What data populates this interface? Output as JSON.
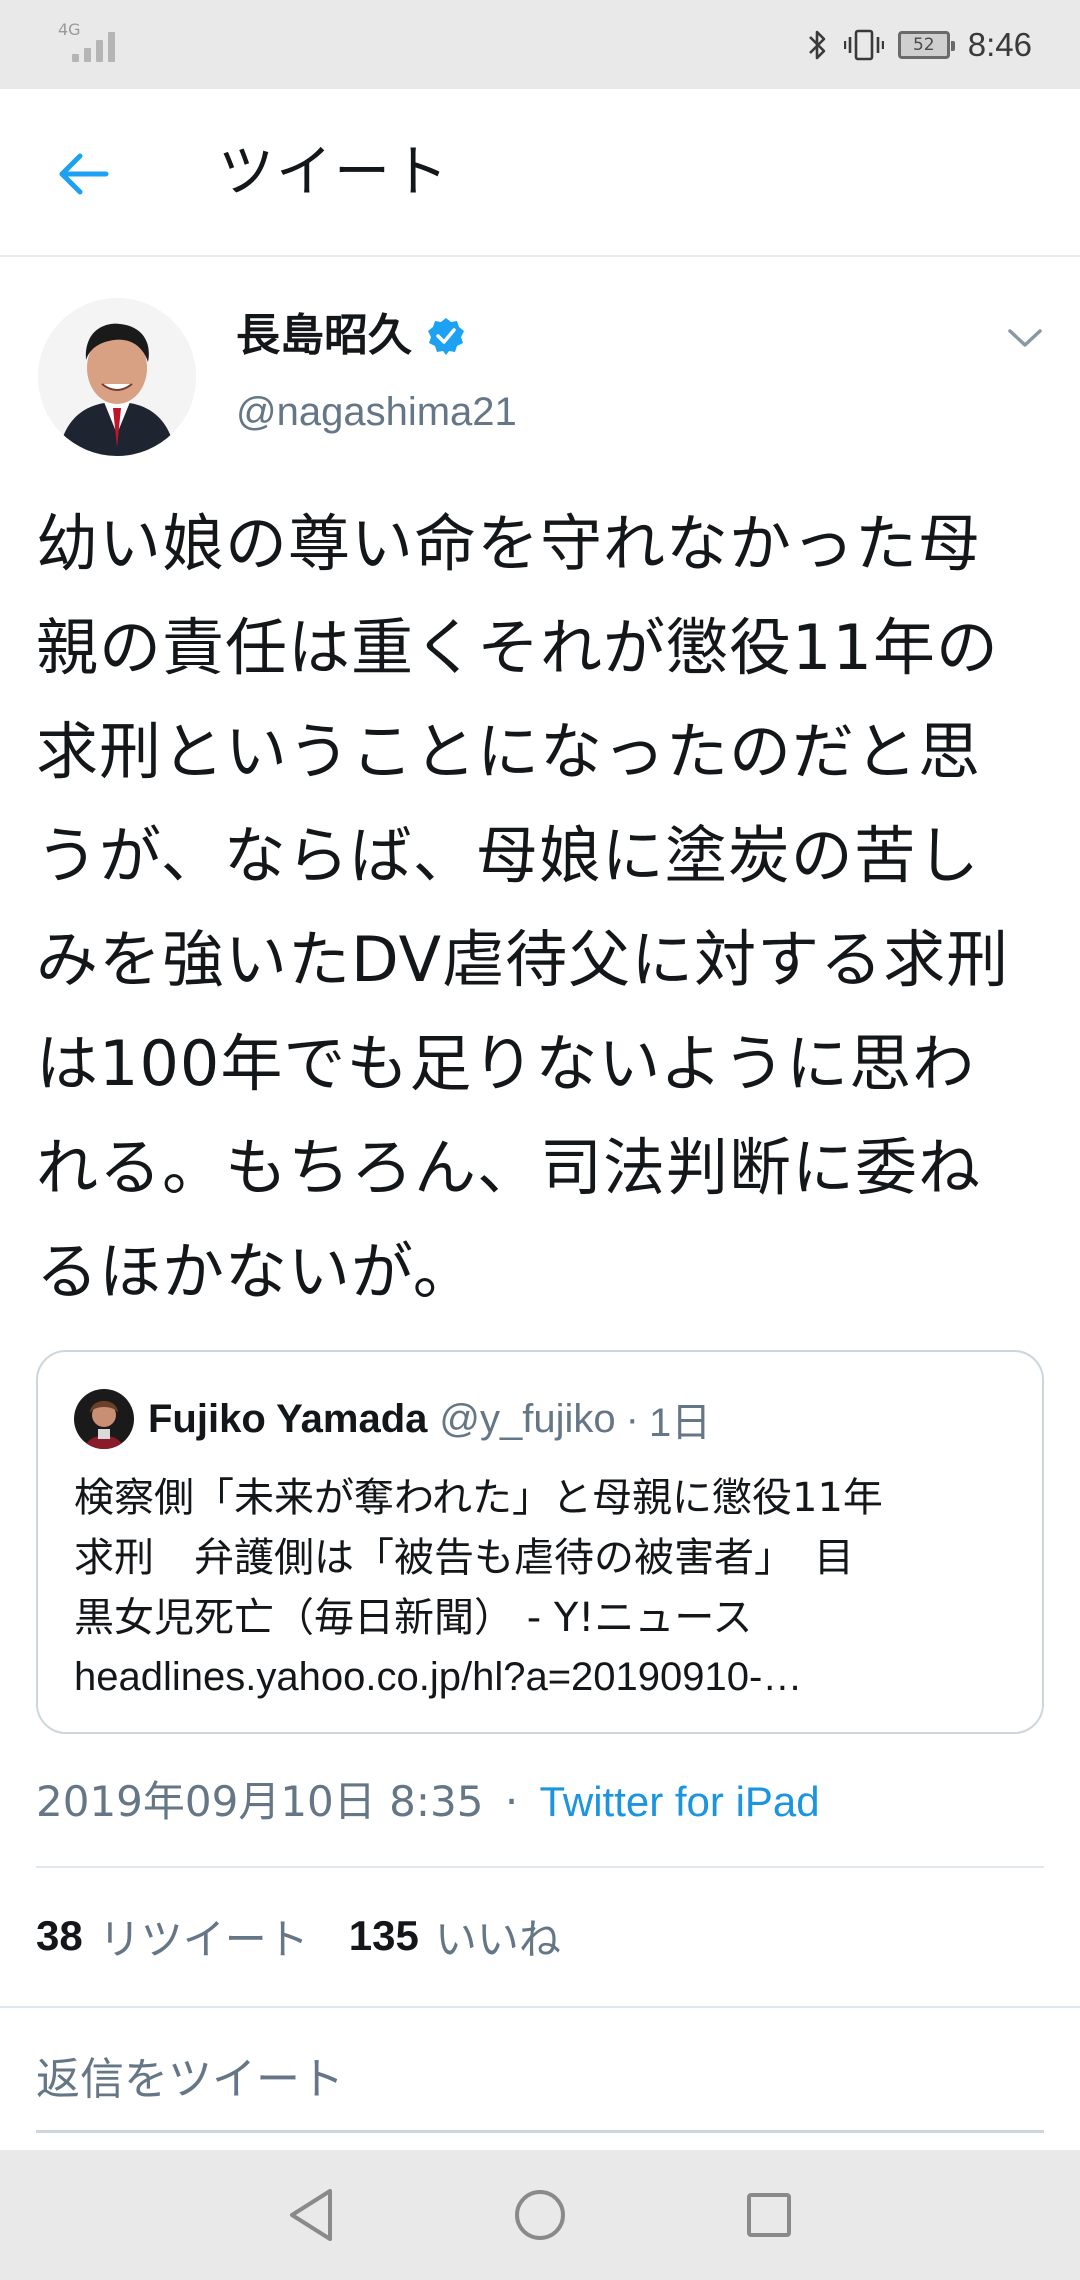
{
  "status_bar": {
    "network": "4G",
    "battery": "52",
    "time": "8:46",
    "icons": [
      "signal-icon",
      "bluetooth-icon",
      "vibrate-icon",
      "battery-icon"
    ]
  },
  "app_bar": {
    "title": "ツイート",
    "back_icon": "arrow-left-icon",
    "accent_color": "#1da1f2"
  },
  "tweet": {
    "display_name": "長島昭久",
    "handle": "@nagashima21",
    "verified": true,
    "text": "幼い娘の尊い命を守れなかった母\n親の責任は重くそれが懲役11年の\n求刑ということになったのだと思\nうが、ならば、母娘に塗炭の苦し\nみを強いたDV虐待父に対する求刑\nは100年でも足りないように思わ\nれる。もちろん、司法判断に委ね\nるほかないが。",
    "quote": {
      "name": "Fujiko Yamada",
      "handle": "@y_fujiko",
      "dot": "·",
      "time": "1日",
      "text": "検察側「未来が奪われた」と母親に懲役11年\n求刑　弁護側は「被告も虐待の被害者」　目\n黒女児死亡（毎日新聞） - Y!ニュース",
      "url": "headlines.yahoo.co.jp/hl?a=20190910-…"
    },
    "date": "2019年09月10日 8:35",
    "meta_separator": "·",
    "source": "Twitter for iPad",
    "retweets": "38",
    "retweets_label": "リツイート",
    "likes": "135",
    "likes_label": "いいね"
  },
  "reply": {
    "placeholder": "返信をツイート"
  },
  "nav_bar": {
    "buttons": [
      "back-triangle-icon",
      "home-circle-icon",
      "recents-square-icon"
    ]
  },
  "colors": {
    "link": "#1b95e0",
    "secondary_text": "#657786",
    "verified": "#1da1f2",
    "border": "#ccd6dd"
  }
}
